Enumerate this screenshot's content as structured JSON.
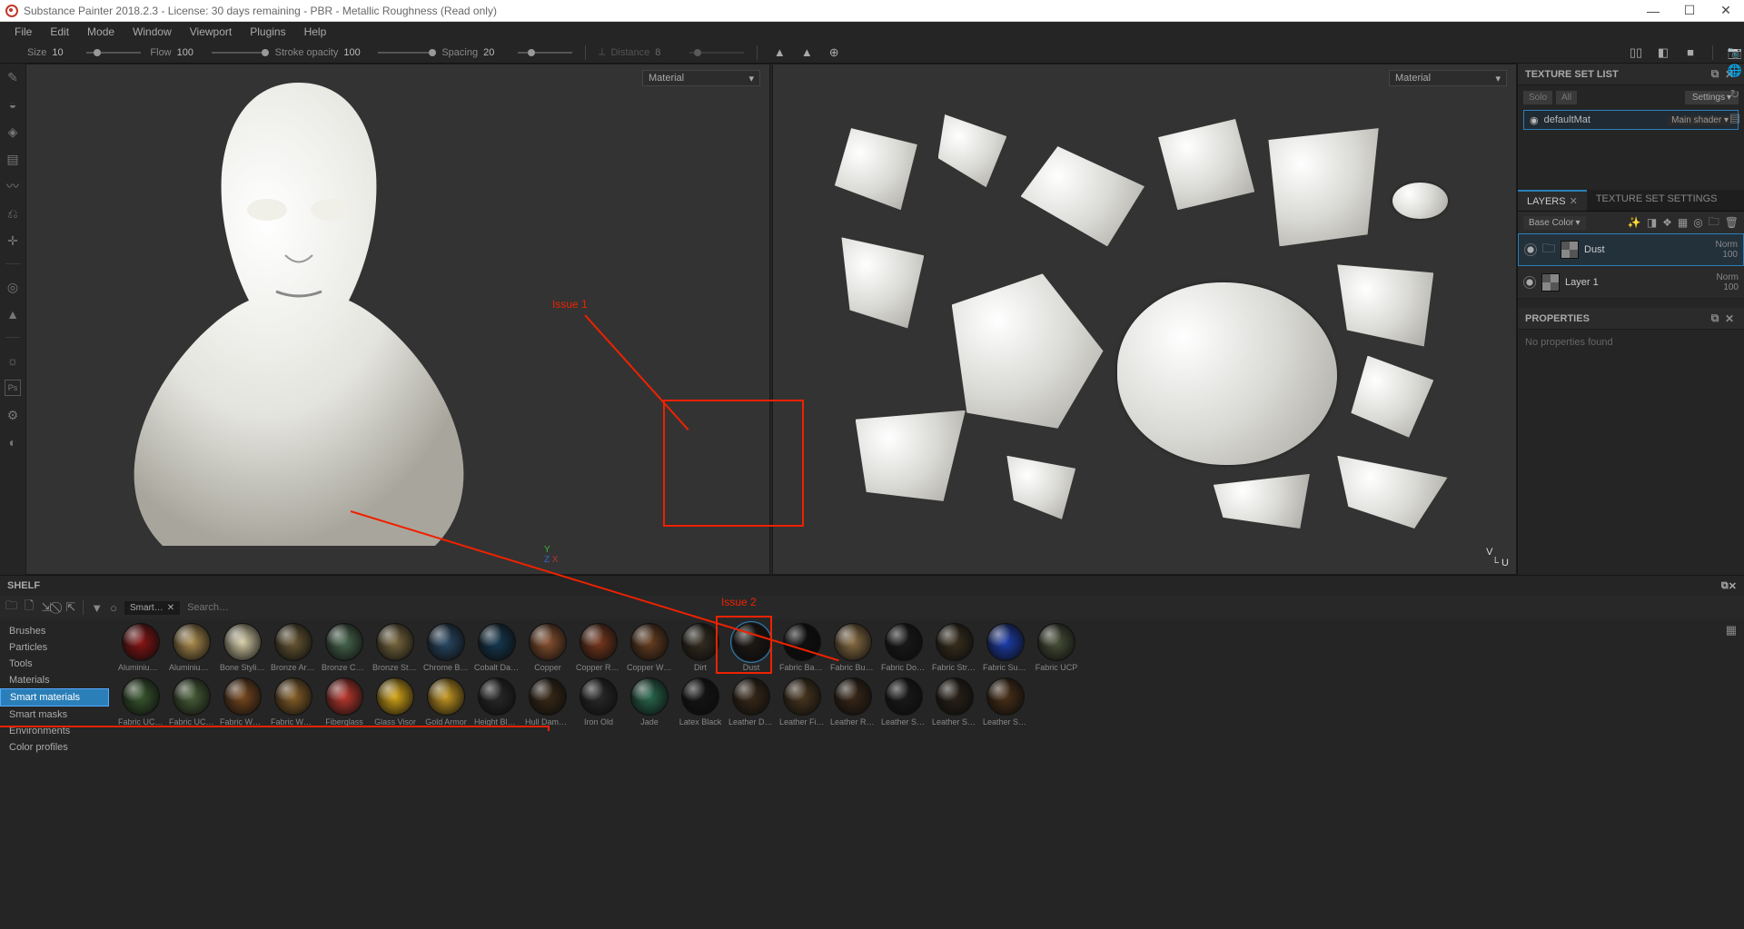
{
  "title": "Substance Painter 2018.2.3 - License: 30 days remaining - PBR - Metallic Roughness (Read only)",
  "menu": [
    "File",
    "Edit",
    "Mode",
    "Window",
    "Viewport",
    "Plugins",
    "Help"
  ],
  "brush": {
    "size_lbl": "Size",
    "size_val": "10",
    "flow_lbl": "Flow",
    "flow_val": "100",
    "opacity_lbl": "Stroke opacity",
    "opacity_val": "100",
    "spacing_lbl": "Spacing",
    "spacing_val": "20",
    "distance_lbl": "Distance",
    "distance_val": "8"
  },
  "viewport": {
    "dropdown": "Material"
  },
  "axis3d": {
    "x": "X",
    "y": "Y",
    "z": "Z"
  },
  "axis2d": {
    "v": "V",
    "u": "U"
  },
  "annotations": {
    "issue1": "Issue 1",
    "issue2": "Issue 2"
  },
  "textureSet": {
    "title": "TEXTURE SET LIST",
    "solo": "Solo",
    "all": "All",
    "settings": "Settings",
    "default_mat": "defaultMat",
    "shader": "Main shader"
  },
  "layersPanel": {
    "tab_layers": "LAYERS",
    "tab_tss": "TEXTURE SET SETTINGS",
    "channel": "Base Color",
    "layers": [
      {
        "name": "Dust",
        "blend": "Norm",
        "opacity": "100"
      },
      {
        "name": "Layer 1",
        "blend": "Norm",
        "opacity": "100"
      }
    ]
  },
  "properties": {
    "title": "PROPERTIES",
    "empty": "No properties found"
  },
  "shelf": {
    "title": "SHELF",
    "filter_chip": "Smart…",
    "search_ph": "Search…",
    "categories": [
      "Brushes",
      "Particles",
      "Tools",
      "Materials",
      "Smart materials",
      "Smart masks",
      "Environments",
      "Color profiles"
    ],
    "active_cat": "Smart materials",
    "row1": [
      "Aluminium …",
      "Aluminium …",
      "Bone Stylized",
      "Bronze Arm…",
      "Bronze Cor…",
      "Bronze Stat…",
      "Chrome Blu…",
      "Cobalt Dam…",
      "Copper",
      "Copper Red…",
      "Copper Worn",
      "Dirt",
      "Dust",
      "Fabric Base…",
      "Fabric Burlap",
      "Fabric Dob…",
      "Fabric Stret…",
      "Fabric Supe…",
      "Fabric UCP"
    ],
    "row2": [
      "Fabric UCP …",
      "Fabric UCP …",
      "Fabric WO…",
      "Fabric WO…",
      "Fiberglass",
      "Glass Visor",
      "Gold Armor",
      "Height Blend",
      "Hull Damag…",
      "Iron Old",
      "Jade",
      "Latex Black",
      "Leather Da…",
      "Leather Fin…",
      "Leather Ro…",
      "Leather Sea…",
      "Leather Sea…",
      "Leather Sofa"
    ],
    "colors1": [
      "#8a1515",
      "#b09050",
      "#d8cfa8",
      "#6a5a35",
      "#4a6a50",
      "#7a6a40",
      "#2a4a66",
      "#163a52",
      "#8a5230",
      "#7a3a20",
      "#6a4022",
      "#352e22",
      "#1e1a15",
      "#0f0f0f",
      "#8a6f44",
      "#1a1a1a",
      "#3a301e",
      "#1e3fb0",
      "#4a523a"
    ],
    "colors2": [
      "#3a5a30",
      "#4a623a",
      "#7a4a20",
      "#8a622a",
      "#c03a30",
      "#d8a818",
      "#c89a22",
      "#2a2a2a",
      "#3a2a18",
      "#2a2a2a",
      "#2a6a50",
      "#151515",
      "#3a2a1a",
      "#4a3820",
      "#3a2818",
      "#1a1a1a",
      "#2a2218",
      "#4a3018"
    ]
  }
}
